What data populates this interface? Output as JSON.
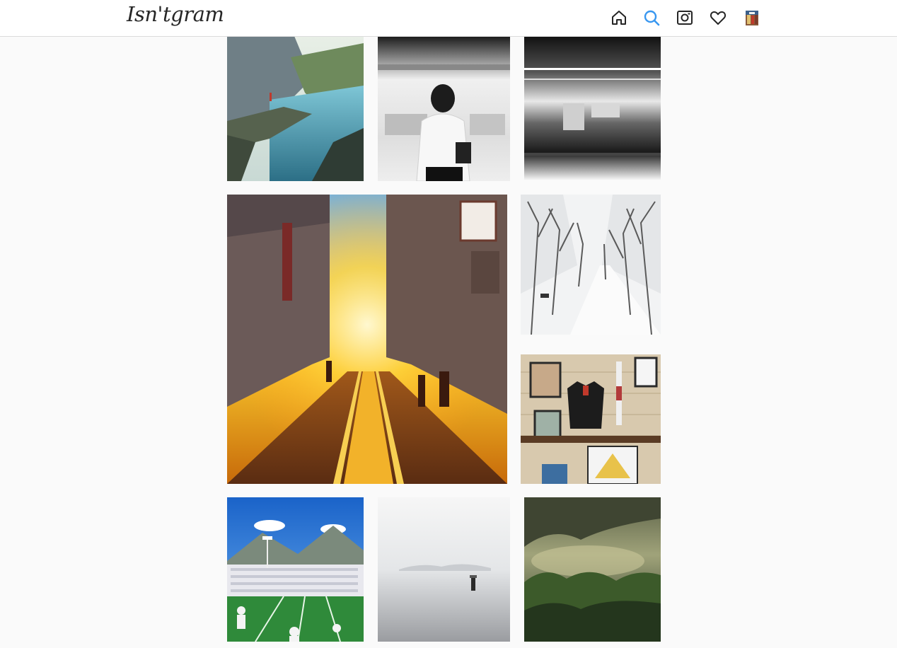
{
  "app": {
    "logo_text": "Isn'tgram"
  },
  "nav": {
    "items": [
      {
        "icon": "home-icon"
      },
      {
        "icon": "search-icon",
        "active": true,
        "active_color": "#3897f0"
      },
      {
        "icon": "camera-icon"
      },
      {
        "icon": "heart-icon"
      },
      {
        "icon": "avatar-icon"
      }
    ]
  },
  "colors": {
    "icon_default": "#262626",
    "icon_active": "#3897f0",
    "background": "#fafafa",
    "header_border": "#dbdbdb"
  },
  "grid": {
    "photos": [
      {
        "subject": "fjord-cliff"
      },
      {
        "subject": "woman-subway"
      },
      {
        "subject": "subway-blur"
      },
      {
        "subject": "sunset-street"
      },
      {
        "subject": "snowy-road"
      },
      {
        "subject": "wall-jacket"
      },
      {
        "subject": "stadium-crowd"
      },
      {
        "subject": "foggy-sea"
      },
      {
        "subject": "misty-forest"
      }
    ]
  }
}
